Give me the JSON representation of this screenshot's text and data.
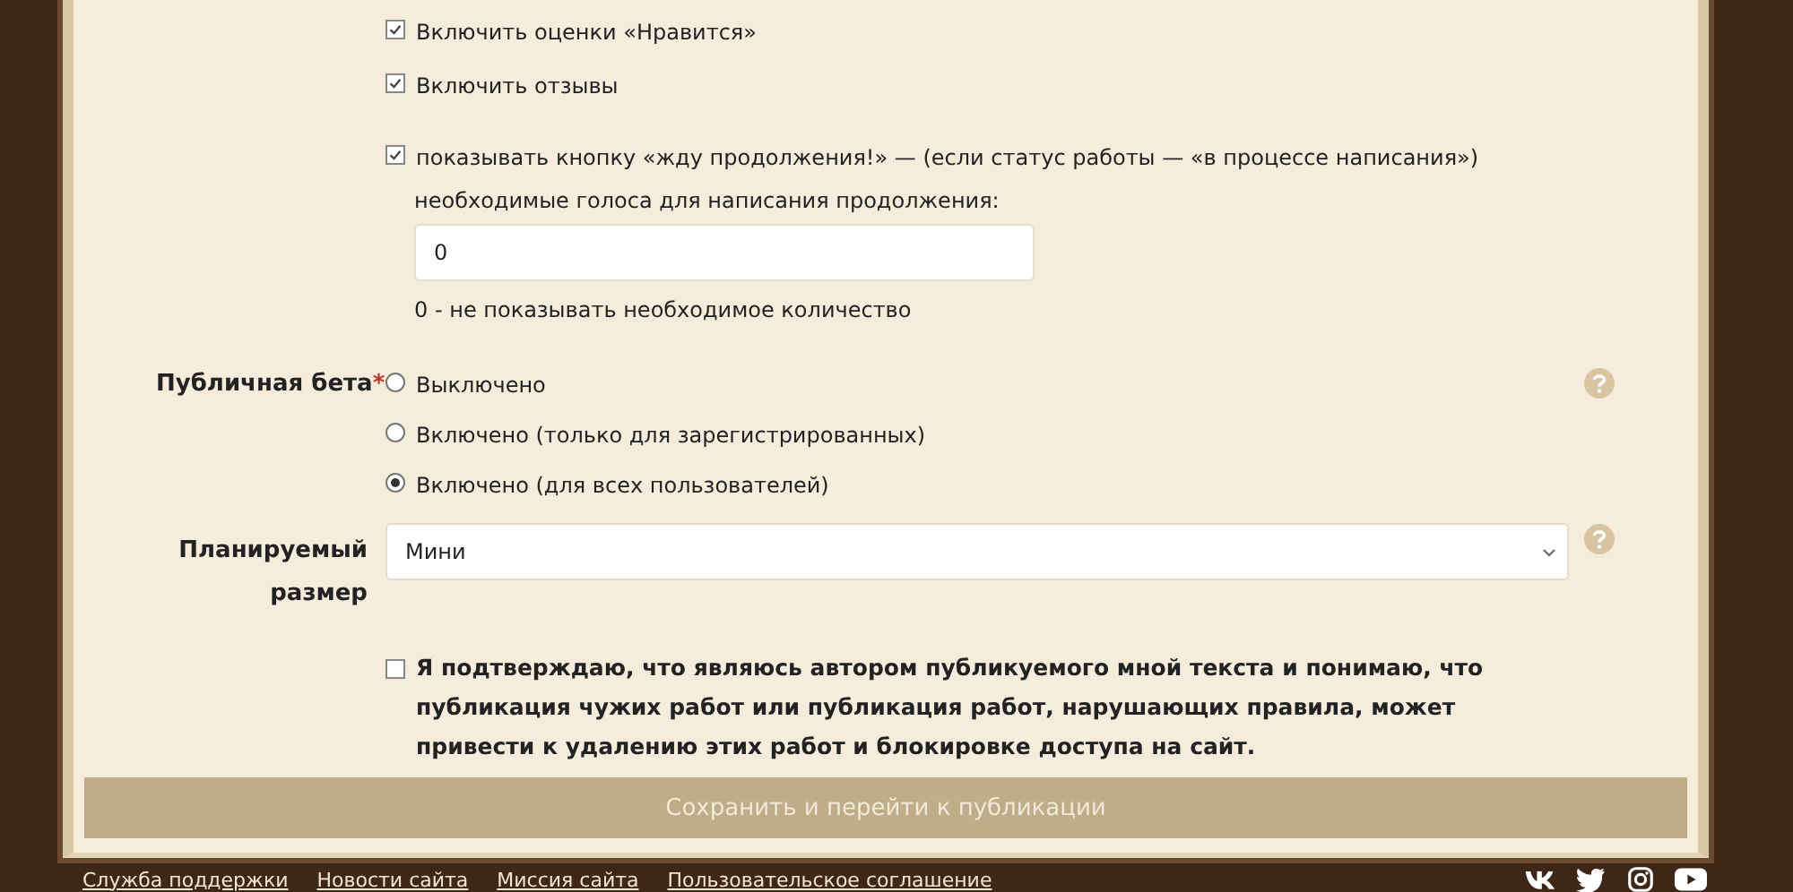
{
  "feedback_options": [
    {
      "label": "Включить оценки «Нравится»",
      "checked": true
    },
    {
      "label": "Включить отзывы",
      "checked": true
    }
  ],
  "wait_button": {
    "label": "показывать кнопку «жду продолжения!» — (если статус работы — «в процессе написания»)",
    "checked": true,
    "votes_label": "необходимые голоса для написания продолжения:",
    "votes_value": "0",
    "votes_hint": "0 - не показывать необходимое количество"
  },
  "public_beta": {
    "label": "Публичная бета",
    "required_marker": "*",
    "options": [
      {
        "label": "Выключено",
        "selected": false
      },
      {
        "label": "Включено (только для зарегистрированных)",
        "selected": false
      },
      {
        "label": "Включено (для всех пользователей)",
        "selected": true
      }
    ]
  },
  "planned_size": {
    "label": "Планируемый размер",
    "value": "Мини"
  },
  "confirm": {
    "label": "Я подтверждаю, что являюсь автором публикуемого мной текста и понимаю, что публикация чужих работ или публикация работ, нарушающих правила, может привести к удалению этих работ и блокировке доступа на сайт.",
    "checked": false
  },
  "submit": {
    "label": "Сохранить и перейти к публикации",
    "disabled": true
  },
  "footer": {
    "links": [
      "Служба поддержки",
      "Новости сайта",
      "Миссия сайта",
      "Пользовательское соглашение"
    ]
  }
}
